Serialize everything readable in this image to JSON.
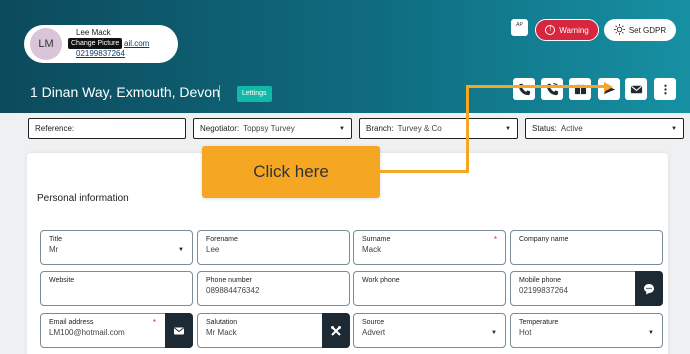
{
  "contact": {
    "initials": "LM",
    "name": "Lee Mack",
    "email_visible": "ail.com",
    "phone": "02199837264",
    "tooltip": "Change Picture"
  },
  "header": {
    "ap_badge": "AP",
    "warning_label": "Warning",
    "gdpr_label": "Set GDPR",
    "address": "1 Dinan Way, Exmouth, Devon",
    "badge": "Lettings"
  },
  "filters": {
    "reference_label": "Reference:",
    "negotiator_label": "Negotiator:",
    "negotiator_value": "Toppsy Turvey",
    "branch_label": "Branch:",
    "branch_value": "Turvey & Co",
    "status_label": "Status:",
    "status_value": "Active"
  },
  "callout": {
    "text": "Click here"
  },
  "personal": {
    "title": "Personal information",
    "fields": {
      "title_label": "Title",
      "title_value": "Mr",
      "forename_label": "Forename",
      "forename_value": "Lee",
      "surname_label": "Surname",
      "surname_value": "Mack",
      "company_label": "Company name",
      "website_label": "Website",
      "phone_label": "Phone number",
      "phone_value": "089884476342",
      "work_label": "Work phone",
      "mobile_label": "Mobile phone",
      "mobile_value": "02199837264",
      "email_label": "Email address",
      "email_value": "LM100@hotmail.com",
      "salutation_label": "Salutation",
      "salutation_value": "Mr Mack",
      "source_label": "Source",
      "source_value": "Advert",
      "temperature_label": "Temperature",
      "temperature_value": "Hot"
    }
  },
  "colors": {
    "accent": "#f5a623",
    "header_dark": "#0c4a5c",
    "warning": "#d7263d",
    "badge": "#13b9a6"
  }
}
